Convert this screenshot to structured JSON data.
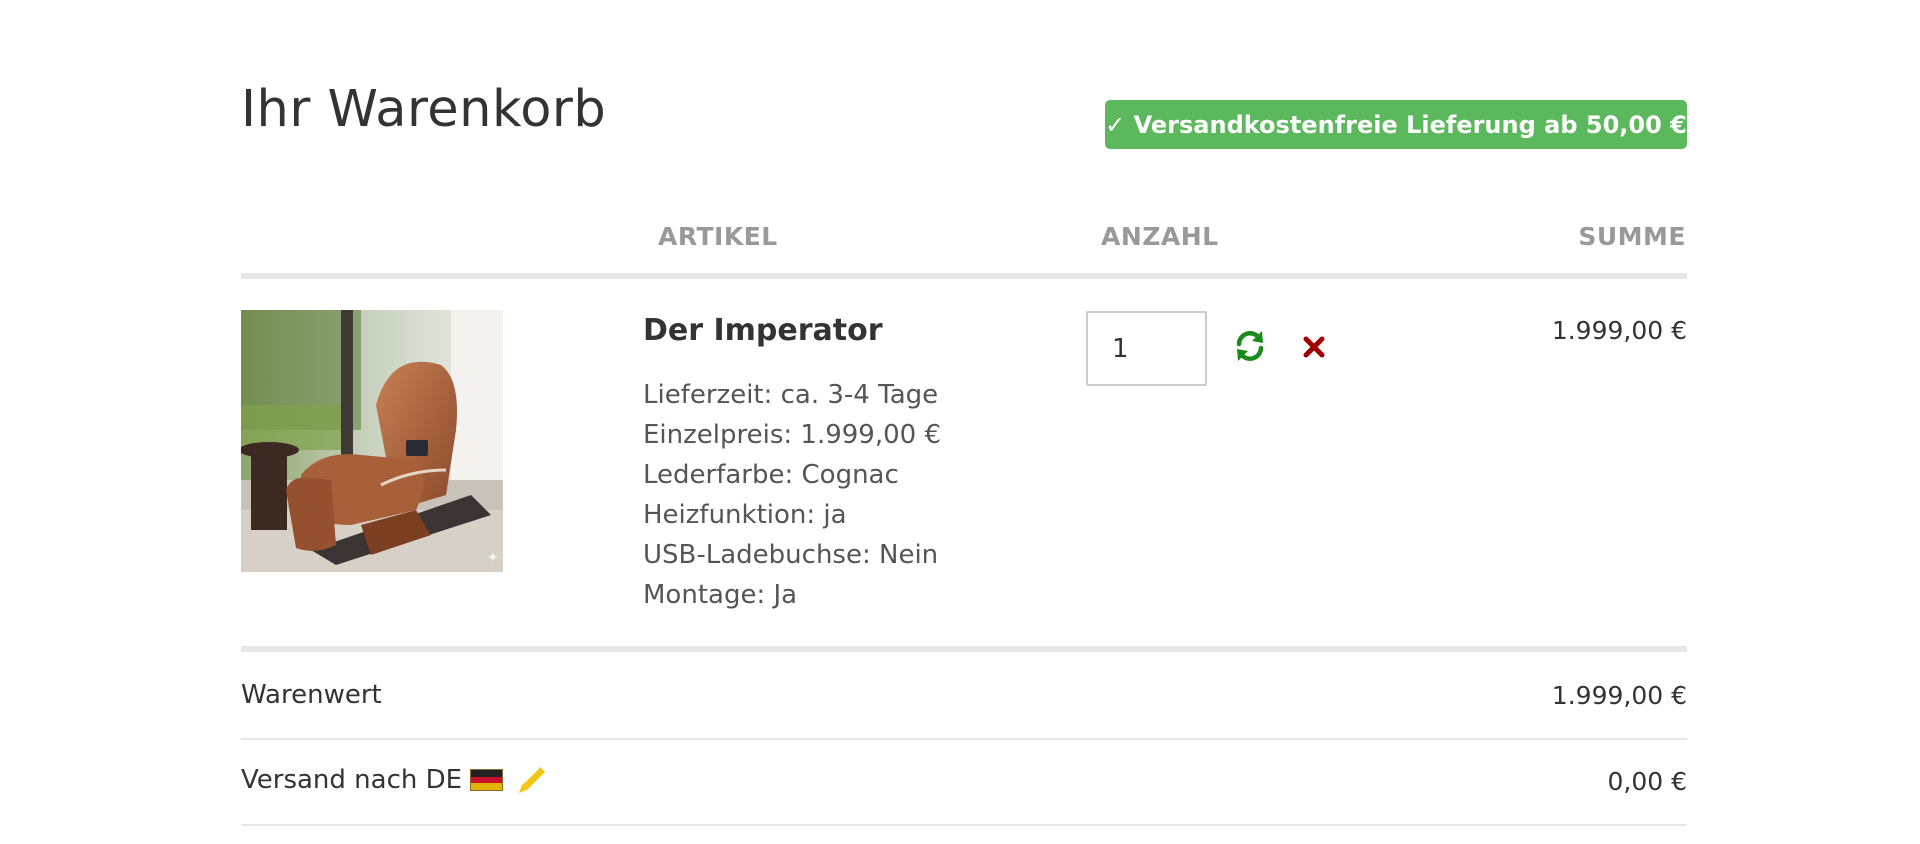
{
  "header": {
    "title": "Ihr Warenkorb",
    "shipping_banner": "✓ Versandkostenfreie Lieferung ab 50,00 €",
    "banner_color": "#5cb85c"
  },
  "table": {
    "columns": [
      "ARTIKEL",
      "ANZAHL",
      "SUMME"
    ]
  },
  "cart_item": {
    "image_alt": "Massagesessel Cognac",
    "name": "Der Imperator",
    "attributes": [
      "Lieferzeit: ca. 3-4 Tage",
      "Einzelpreis: 1.999,00 €",
      "Lederfarbe: Cognac",
      "Heizfunktion: ja",
      "USB-Ladebuchse: Nein",
      "Montage: Ja"
    ],
    "quantity": "1",
    "total": "1.999,00 €",
    "refresh_icon": "refresh-icon",
    "remove_icon": "close-icon",
    "refresh_color": "#1a8a1a",
    "remove_color": "#a00000"
  },
  "summary": {
    "subtotal_label": "Warenwert",
    "subtotal_value": "1.999,00 €",
    "shipping_label": "Versand nach DE",
    "shipping_value": "0,00 €",
    "flag_icon": "germany-flag-icon",
    "edit_icon": "pencil-icon",
    "edit_color": "#f2c511"
  }
}
